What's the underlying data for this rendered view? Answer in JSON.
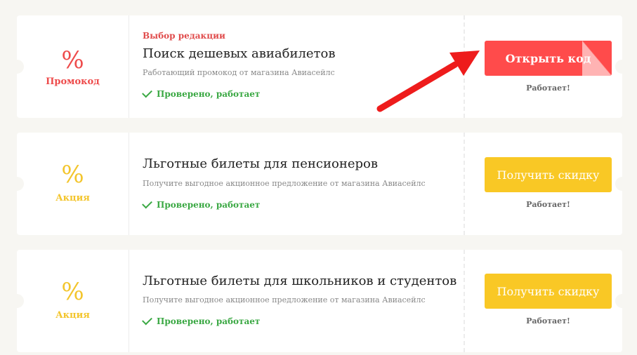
{
  "offers": [
    {
      "symbol": "%",
      "type_label": "Промокод",
      "color": "red",
      "editor_choice": "Выбор редакции",
      "title": "Поиск дешевых авиабилетов",
      "description": "Работающий промокод от магазина Авиасейлс",
      "verified": "Проверено, работает",
      "button_label": "Открыть код",
      "status": "Работает!"
    },
    {
      "symbol": "%",
      "type_label": "Акция",
      "color": "yellow",
      "title": "Льготные билеты для пенсионеров",
      "description": "Получите выгодное акционное предложение от магазина Авиасейлс",
      "verified": "Проверено, работает",
      "button_label": "Получить скидку",
      "status": "Работает!"
    },
    {
      "symbol": "%",
      "type_label": "Акция",
      "color": "yellow",
      "title": "Льготные билеты для школьников и студентов",
      "description": "Получите выгодное акционное предложение от магазина Авиасейлс",
      "verified": "Проверено, работает",
      "button_label": "Получить скидку",
      "status": "Работает!"
    }
  ],
  "colors": {
    "red": "#ff4b4b",
    "yellow": "#f9c825",
    "green": "#3aa843",
    "arrow": "#ee1c1c"
  },
  "icons": [
    "percent-icon",
    "check-icon",
    "red-arrow-annotation"
  ]
}
